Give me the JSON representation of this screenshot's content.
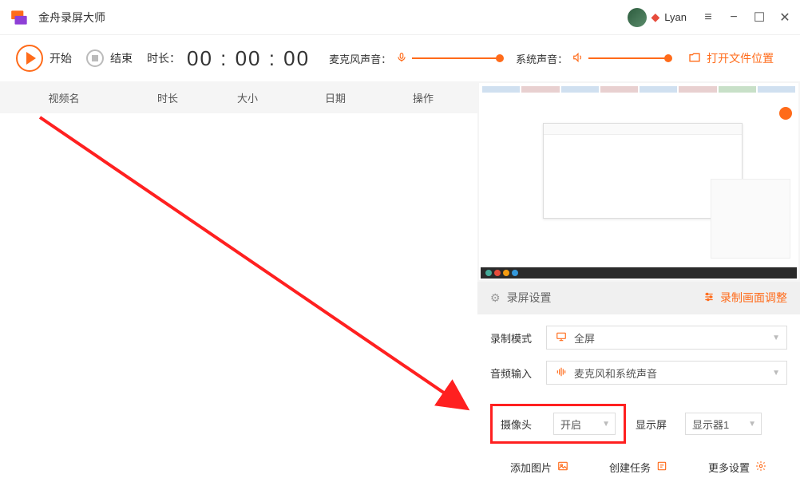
{
  "app": {
    "title": "金舟录屏大师"
  },
  "user": {
    "name": "Lyan"
  },
  "toolbar": {
    "start_label": "开始",
    "end_label": "结束",
    "duration_label": "时长：",
    "duration_value": "00 : 00 : 00",
    "mic_label": "麦克风声音：",
    "system_label": "系统声音：",
    "open_folder": "打开文件位置"
  },
  "table": {
    "headers": {
      "name": "视频名",
      "duration": "时长",
      "size": "大小",
      "date": "日期",
      "operation": "操作"
    }
  },
  "settings": {
    "header_title": "录屏设置",
    "adjust_label": "录制画面调整",
    "record_mode": {
      "label": "录制模式",
      "value": "全屏"
    },
    "audio_input": {
      "label": "音频输入",
      "value": "麦克风和系统声音"
    },
    "camera": {
      "label": "摄像头",
      "value": "开启"
    },
    "display": {
      "label": "显示屏",
      "value": "显示器1"
    },
    "actions": {
      "add_image": "添加图片",
      "create_task": "创建任务",
      "more_settings": "更多设置"
    }
  }
}
